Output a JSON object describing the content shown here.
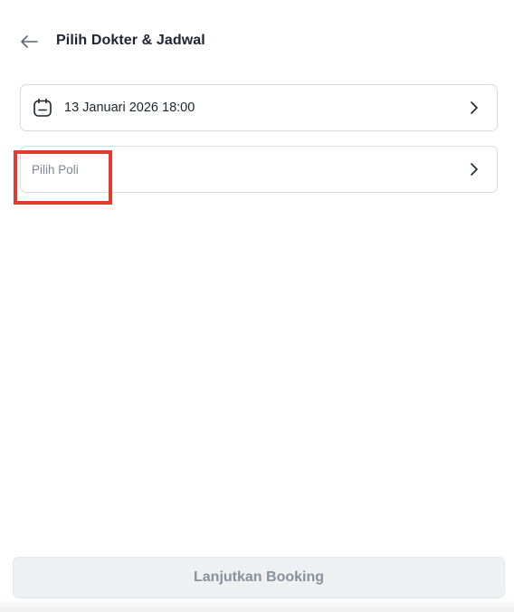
{
  "header": {
    "title": "Pilih Dokter & Jadwal",
    "back_icon": "arrow-left-icon"
  },
  "form": {
    "date_field": {
      "icon": "calendar-icon",
      "value": "13 Januari 2026 18:00",
      "chevron_icon": "chevron-right-icon"
    },
    "poli_field": {
      "placeholder": "Pilih Poli",
      "chevron_icon": "chevron-right-icon"
    }
  },
  "footer": {
    "continue_label": "Lanjutkan Booking",
    "disabled": true
  },
  "colors": {
    "text_primary": "#1f2430",
    "placeholder": "#7d8493",
    "border": "#d7dadf",
    "button_disabled_bg": "#eef0f3",
    "button_disabled_text": "#8a909c",
    "highlight": "#e53a2e"
  }
}
